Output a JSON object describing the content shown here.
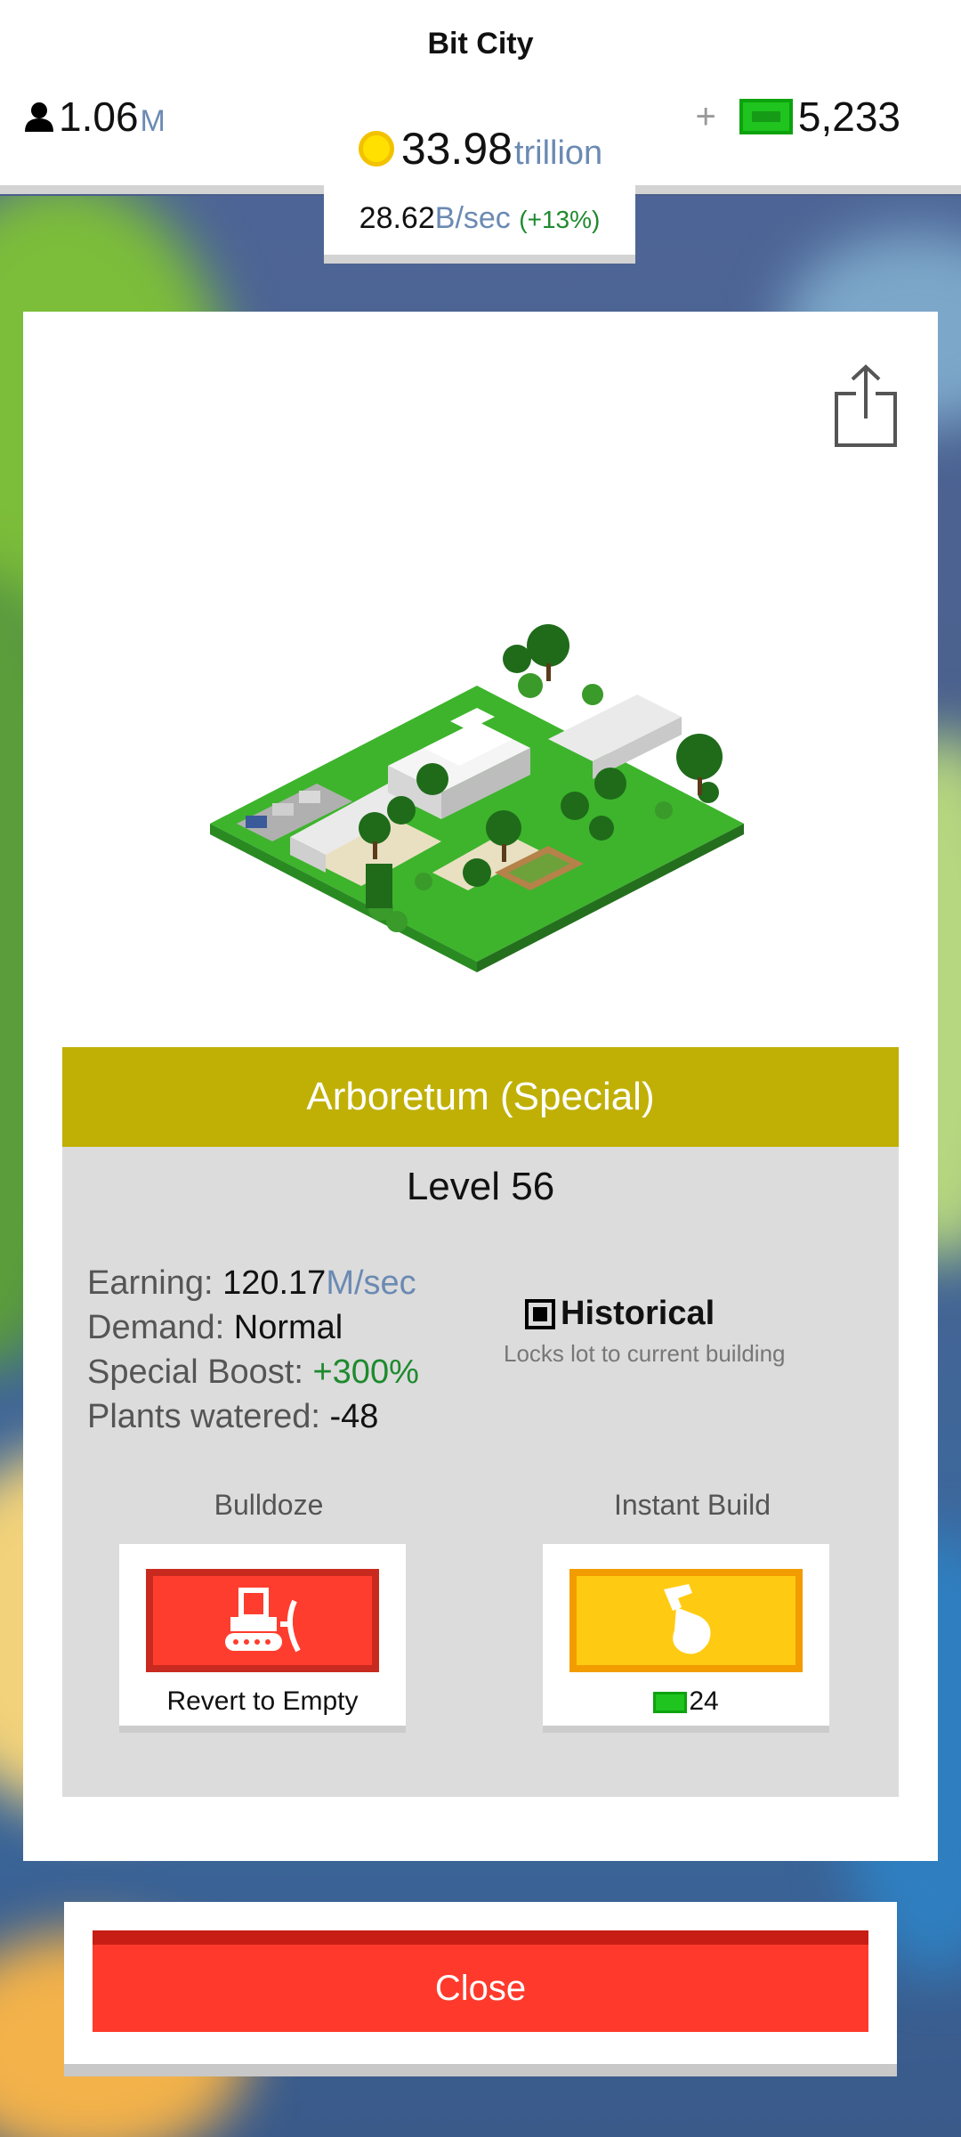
{
  "header": {
    "title": "Bit City",
    "population_value": "1.06",
    "population_unit": "M",
    "plus_label": "+",
    "cash_value": "5,233",
    "coins_value": "33.98",
    "coins_unit": "trillion",
    "rate_value": "28.62",
    "rate_unit": "B/sec",
    "rate_pct": "(+13%)"
  },
  "building": {
    "name": "Arboretum (Special)",
    "level": "Level 56",
    "stats": {
      "earning_label": "Earning: ",
      "earning_value": "120.17",
      "earning_unit": "M/sec",
      "demand_label": "Demand: ",
      "demand_value": "Normal",
      "boost_label": "Special Boost: ",
      "boost_value": "+300%",
      "plants_label": "Plants watered: ",
      "plants_value": "-48"
    },
    "historical": {
      "label": "Historical",
      "description": "Locks lot to current building"
    }
  },
  "actions": {
    "bulldoze_title": "Bulldoze",
    "bulldoze_caption": "Revert to Empty",
    "instant_title": "Instant Build",
    "instant_cost": "24"
  },
  "close_label": "Close",
  "icons": [
    "person-icon",
    "bill-icon",
    "coin-icon",
    "share-icon",
    "bulldozer-icon",
    "hammer-icon"
  ]
}
